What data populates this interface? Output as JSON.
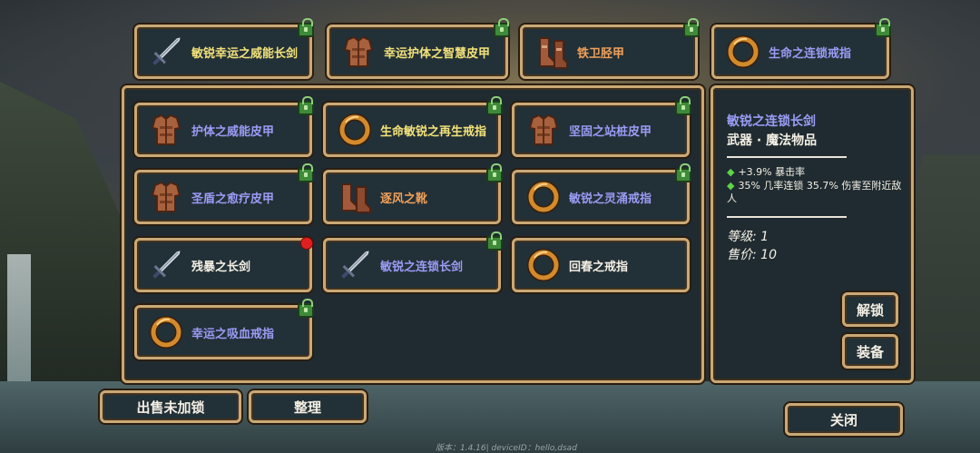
{
  "colors": {
    "frame_gold": "#caa977",
    "panel_dark": "#1f2b30",
    "name_yellow": "#f3e27a",
    "name_blue": "#9a9cf4",
    "name_white": "#f4efe4",
    "name_orange": "#f0a05a",
    "stat_green": "#5ed447",
    "lock_green": "#3f8a3a"
  },
  "equipped": [
    {
      "name": "敏锐幸运之威能长剑",
      "icon": "sword-icon",
      "color": "yellow",
      "locked": true
    },
    {
      "name": "幸运护体之智慧皮甲",
      "icon": "leather-armor-icon",
      "color": "yellow",
      "locked": true
    },
    {
      "name": "铁卫胫甲",
      "icon": "greaves-icon",
      "color": "orange",
      "locked": true
    },
    {
      "name": "生命之连锁戒指",
      "icon": "ring-icon",
      "color": "blue",
      "locked": true
    }
  ],
  "inventory": [
    {
      "name": "护体之威能皮甲",
      "icon": "leather-armor-icon",
      "color": "blue",
      "locked": true
    },
    {
      "name": "生命敏锐之再生戒指",
      "icon": "ring-icon",
      "color": "yellow",
      "locked": true
    },
    {
      "name": "坚固之站桩皮甲",
      "icon": "leather-armor-icon",
      "color": "blue",
      "locked": true
    },
    {
      "name": "圣盾之愈疗皮甲",
      "icon": "leather-armor-icon",
      "color": "blue",
      "locked": true
    },
    {
      "name": "逐风之靴",
      "icon": "boots-icon",
      "color": "orange",
      "locked": true
    },
    {
      "name": "敏锐之灵涌戒指",
      "icon": "ring-icon",
      "color": "blue",
      "locked": true
    },
    {
      "name": "残暴之长剑",
      "icon": "sword-icon",
      "color": "white",
      "locked": false,
      "new": true
    },
    {
      "name": "敏锐之连锁长剑",
      "icon": "sword-icon",
      "color": "blue",
      "locked": true
    },
    {
      "name": "回春之戒指",
      "icon": "ring-icon",
      "color": "white",
      "locked": false
    },
    {
      "name": "幸运之吸血戒指",
      "icon": "ring-icon",
      "color": "blue",
      "locked": true
    }
  ],
  "detail": {
    "title": "敏锐之连锁长剑",
    "subtitle": "武器 · 魔法物品",
    "stats": [
      "+3.9% 暴击率",
      "35% 几率连锁 35.7% 伤害至附近敌人"
    ],
    "level": "等级: 1",
    "price": "售价: 10",
    "unlock_label": "解锁",
    "equip_label": "装备"
  },
  "buttons": {
    "sell_unlocked": "出售未加锁",
    "sort": "整理",
    "close": "关闭"
  },
  "footer": "版本：1.4.16| deviceID：hello,dsad"
}
